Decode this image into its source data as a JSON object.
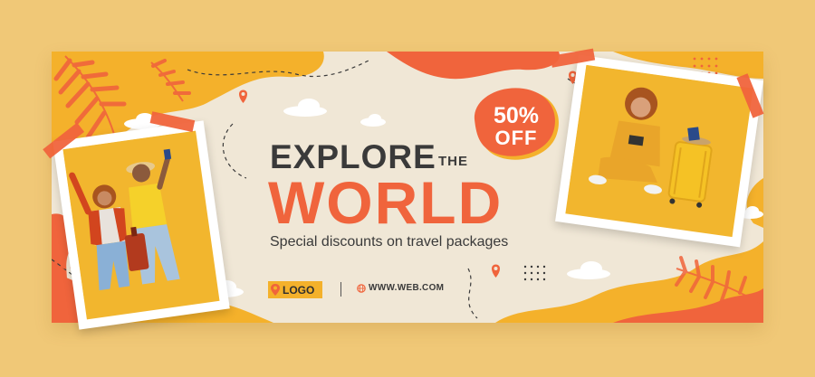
{
  "headline": {
    "explore": "EXPLORE",
    "the": "THE",
    "world": "WORLD"
  },
  "subtitle": "Special discounts on travel packages",
  "badge": {
    "percent": "50%",
    "off": "OFF"
  },
  "footer": {
    "logo_label": "LOGO",
    "website": "WWW.WEB.COM"
  },
  "colors": {
    "accent_orange": "#f0643c",
    "accent_yellow": "#f4b12b",
    "background": "#f0c877",
    "card": "#f0e7d6"
  },
  "icons": [
    "location-pin-icon",
    "globe-icon",
    "cloud-icon",
    "palm-leaf-icon"
  ]
}
